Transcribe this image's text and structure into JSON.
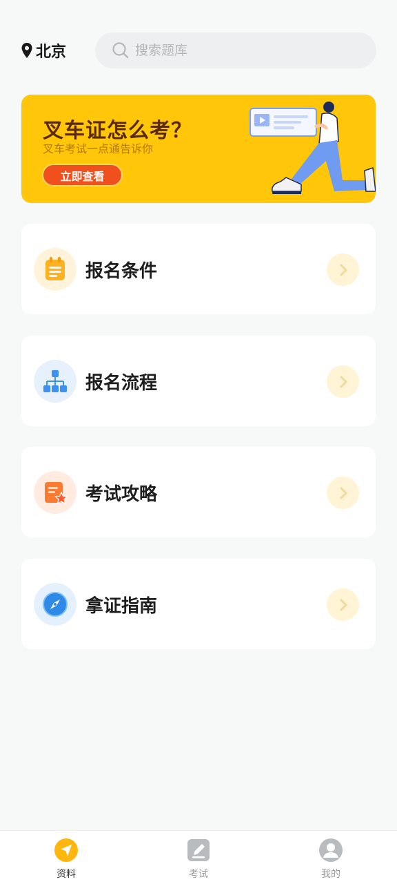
{
  "header": {
    "city": "北京",
    "search_placeholder": "搜索题库"
  },
  "banner": {
    "title": "叉车证怎么考？",
    "subtitle": "叉车考试一点通告诉你",
    "button": "立即查看"
  },
  "cards": [
    {
      "label": "报名条件",
      "icon": "calendar-note-icon"
    },
    {
      "label": "报名流程",
      "icon": "flowchart-icon"
    },
    {
      "label": "考试攻略",
      "icon": "doc-star-icon"
    },
    {
      "label": "拿证指南",
      "icon": "compass-icon"
    }
  ],
  "tabs": [
    {
      "label": "资料",
      "icon": "navigation-icon",
      "active": true
    },
    {
      "label": "考试",
      "icon": "edit-icon",
      "active": false
    },
    {
      "label": "我的",
      "icon": "user-icon",
      "active": false
    }
  ],
  "colors": {
    "accent": "#ffc60a",
    "banner_button": "#f0501e",
    "background": "#f7f8f8"
  }
}
